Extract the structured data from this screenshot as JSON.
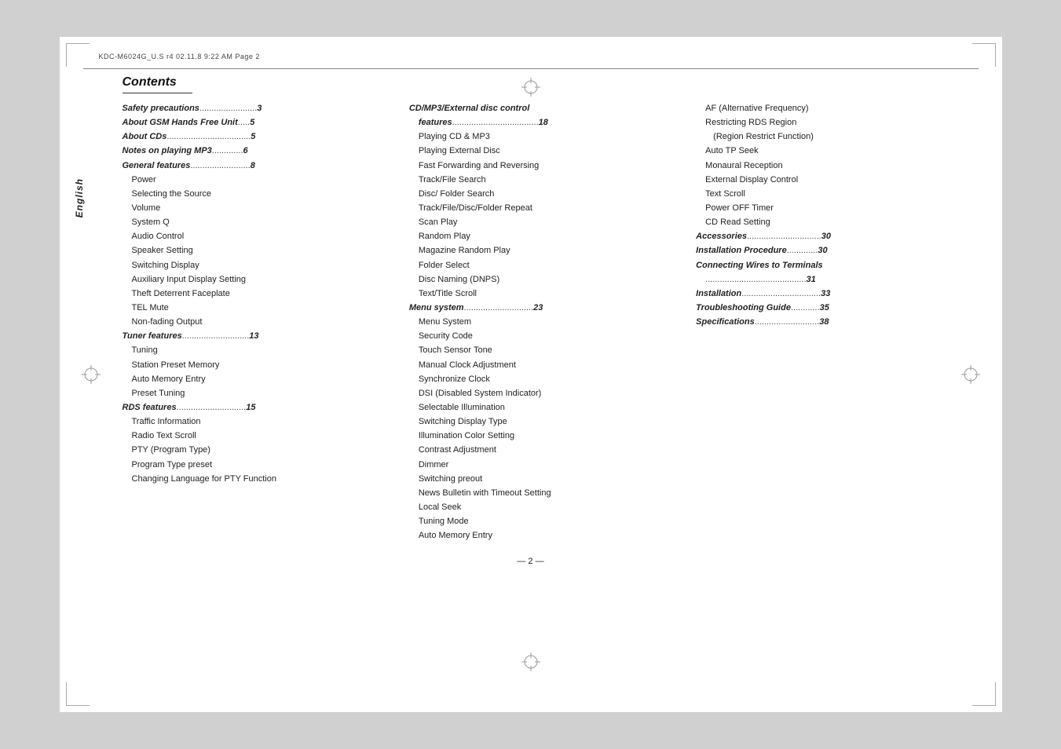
{
  "fileInfo": "KDC-M6024G_U.S  r4   02.11.8   9:22 AM    Page 2",
  "sideLabel": "English",
  "contentsTitle": "Contents",
  "col1": {
    "entries": [
      {
        "type": "bold-dots",
        "label": "Safety precautions",
        "dots": "........................",
        "page": "3"
      },
      {
        "type": "bold-dots",
        "label": "About GSM Hands Free Unit ",
        "dots": ".....",
        "page": "5"
      },
      {
        "type": "bold-dots",
        "label": "About CDs",
        "dots": "...................................",
        "page": "5"
      },
      {
        "type": "bold-dots",
        "label": "Notes on playing MP3 ",
        "dots": ".............",
        "page": "6"
      },
      {
        "type": "bold-dots",
        "label": "General features ",
        "dots": ".........................",
        "page": "8"
      },
      {
        "type": "sub",
        "label": "Power"
      },
      {
        "type": "sub",
        "label": "Selecting the Source"
      },
      {
        "type": "sub",
        "label": "Volume"
      },
      {
        "type": "sub",
        "label": "System Q"
      },
      {
        "type": "sub",
        "label": "Audio Control"
      },
      {
        "type": "sub",
        "label": "Speaker Setting"
      },
      {
        "type": "sub",
        "label": "Switching Display"
      },
      {
        "type": "sub",
        "label": "Auxiliary Input Display Setting"
      },
      {
        "type": "sub",
        "label": "Theft Deterrent Faceplate"
      },
      {
        "type": "sub",
        "label": "TEL Mute"
      },
      {
        "type": "sub",
        "label": "Non-fading Output"
      },
      {
        "type": "bold-dots",
        "label": "Tuner features",
        "dots": "............................",
        "page": "13"
      },
      {
        "type": "sub",
        "label": "Tuning"
      },
      {
        "type": "sub",
        "label": "Station Preset Memory"
      },
      {
        "type": "sub",
        "label": "Auto Memory Entry"
      },
      {
        "type": "sub",
        "label": "Preset Tuning"
      },
      {
        "type": "bold-dots",
        "label": "RDS features",
        "dots": ".............................",
        "page": "15"
      },
      {
        "type": "sub",
        "label": "Traffic Information"
      },
      {
        "type": "sub",
        "label": "Radio Text Scroll"
      },
      {
        "type": "sub",
        "label": "PTY (Program Type)"
      },
      {
        "type": "sub",
        "label": "Program Type preset"
      },
      {
        "type": "sub",
        "label": "Changing Language for PTY Function"
      }
    ]
  },
  "col2": {
    "entries": [
      {
        "type": "bold",
        "label": "CD/MP3/External disc control"
      },
      {
        "type": "bold-dots-cont",
        "label": "  features ",
        "dots": "....................................",
        "page": "18"
      },
      {
        "type": "sub",
        "label": "Playing CD & MP3"
      },
      {
        "type": "sub",
        "label": "Playing External Disc"
      },
      {
        "type": "sub",
        "label": "Fast Forwarding and Reversing"
      },
      {
        "type": "sub",
        "label": "Track/File Search"
      },
      {
        "type": "sub",
        "label": "Disc/ Folder Search"
      },
      {
        "type": "sub",
        "label": "Track/File/Disc/Folder Repeat"
      },
      {
        "type": "sub",
        "label": "Scan Play"
      },
      {
        "type": "sub",
        "label": "Random Play"
      },
      {
        "type": "sub",
        "label": "Magazine Random Play"
      },
      {
        "type": "sub",
        "label": "Folder Select"
      },
      {
        "type": "sub",
        "label": "Disc Naming (DNPS)"
      },
      {
        "type": "sub",
        "label": "Text/Title Scroll"
      },
      {
        "type": "bold-dots",
        "label": "Menu system",
        "dots": ".............................",
        "page": "23"
      },
      {
        "type": "sub",
        "label": "Menu System"
      },
      {
        "type": "sub",
        "label": "Security Code"
      },
      {
        "type": "sub",
        "label": "Touch Sensor Tone"
      },
      {
        "type": "sub",
        "label": "Manual Clock Adjustment"
      },
      {
        "type": "sub",
        "label": "Synchronize Clock"
      },
      {
        "type": "sub",
        "label": "DSI (Disabled System Indicator)"
      },
      {
        "type": "sub",
        "label": "Selectable Illumination"
      },
      {
        "type": "sub",
        "label": "Switching Display Type"
      },
      {
        "type": "sub",
        "label": "Illumination Color Setting"
      },
      {
        "type": "sub",
        "label": "Contrast Adjustment"
      },
      {
        "type": "sub",
        "label": "Dimmer"
      },
      {
        "type": "sub",
        "label": "Switching preout"
      },
      {
        "type": "sub",
        "label": "News Bulletin with Timeout Setting"
      },
      {
        "type": "sub",
        "label": "Local Seek"
      },
      {
        "type": "sub",
        "label": "Tuning Mode"
      },
      {
        "type": "sub",
        "label": "Auto Memory Entry"
      }
    ]
  },
  "col3": {
    "entries": [
      {
        "type": "sub",
        "label": "AF (Alternative Frequency)"
      },
      {
        "type": "sub",
        "label": "Restricting RDS Region"
      },
      {
        "type": "sub2",
        "label": "(Region Restrict Function)"
      },
      {
        "type": "sub",
        "label": "Auto TP Seek"
      },
      {
        "type": "sub",
        "label": "Monaural Reception"
      },
      {
        "type": "sub",
        "label": "External Display Control"
      },
      {
        "type": "sub",
        "label": "Text Scroll"
      },
      {
        "type": "sub",
        "label": "Power OFF Timer"
      },
      {
        "type": "sub",
        "label": "CD Read Setting"
      },
      {
        "type": "bold-dots",
        "label": "Accessories",
        "dots": "...............................",
        "page": "30"
      },
      {
        "type": "bold-dots",
        "label": "Installation Procedure ",
        "dots": ".............",
        "page": "30"
      },
      {
        "type": "bold-dots2",
        "label": "Connecting Wires to Terminals",
        "page": "31"
      },
      {
        "type": "bold-dots",
        "label": "Installation ",
        "dots": ".................................",
        "page": "33"
      },
      {
        "type": "bold-dots",
        "label": "Troubleshooting Guide ",
        "dots": "............",
        "page": "35"
      },
      {
        "type": "bold-dots",
        "label": "Specifications ",
        "dots": "...........................",
        "page": "38"
      }
    ]
  },
  "pageNumber": "— 2 —"
}
